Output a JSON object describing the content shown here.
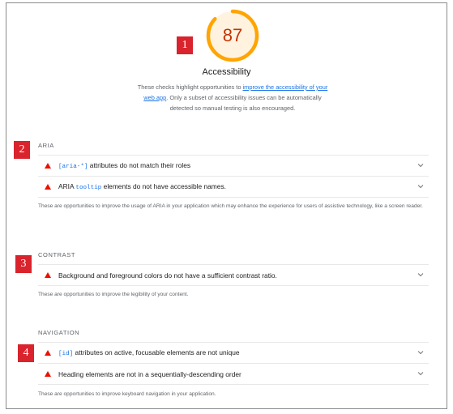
{
  "colors": {
    "gauge_arc": "#ffa400",
    "gauge_track": "#fff3e0",
    "score_text": "#c33300",
    "fail_triangle": "#eb0f00",
    "marker_bg": "#d9232d",
    "link": "#1a73e8"
  },
  "gauge": {
    "score": "87",
    "fraction": 0.87
  },
  "header": {
    "title": "Accessibility",
    "desc_pre": "These checks highlight opportunities to ",
    "desc_link_1": "improve the accessibility of your",
    "desc_link_2": "web app",
    "desc_post": ". Only a subset of accessibility issues can be automatically detected so manual testing is also encouraged."
  },
  "markers": [
    "1",
    "2",
    "3",
    "4"
  ],
  "sections": {
    "aria": {
      "title": "ARIA",
      "audits": [
        {
          "code": "[aria-*]",
          "text": " attributes do not match their roles",
          "icon": "fail-triangle-icon"
        },
        {
          "prefix": "ARIA ",
          "code": "tooltip",
          "text": " elements do not have accessible names.",
          "icon": "fail-triangle-icon"
        }
      ],
      "note": "These are opportunities to improve the usage of ARIA in your application which may enhance the experience for users of assistive technology, like a screen reader."
    },
    "contrast": {
      "title": "CONTRAST",
      "audits": [
        {
          "text": "Background and foreground colors do not have a sufficient contrast ratio.",
          "icon": "fail-triangle-icon"
        }
      ],
      "note": "These are opportunities to improve the legibility of your content."
    },
    "navigation": {
      "title": "NAVIGATION",
      "audits": [
        {
          "code": "[id]",
          "text": " attributes on active, focusable elements are not unique",
          "icon": "fail-triangle-icon"
        },
        {
          "text": "Heading elements are not in a sequentially-descending order",
          "icon": "fail-triangle-icon"
        }
      ],
      "note": "These are opportunities to improve keyboard navigation in your application."
    }
  }
}
